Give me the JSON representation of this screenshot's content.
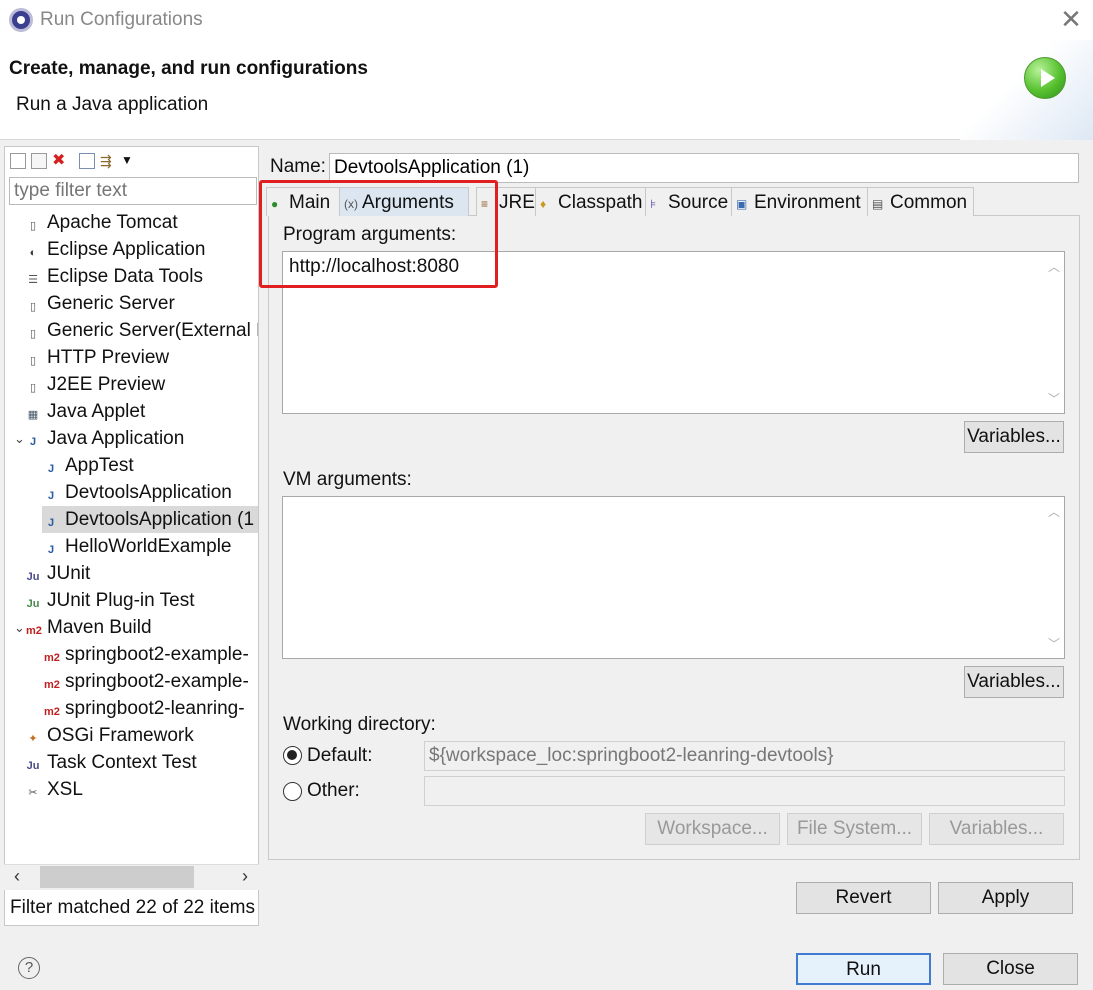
{
  "window": {
    "title": "Run Configurations"
  },
  "header": {
    "title": "Create, manage, and run configurations",
    "subtitle": "Run a Java application"
  },
  "filter": {
    "placeholder": "type filter text"
  },
  "tree": [
    {
      "label": "Apache Tomcat",
      "icon": "server-icon",
      "level": 0
    },
    {
      "label": "Eclipse Application",
      "icon": "eclipse-icon",
      "level": 0
    },
    {
      "label": "Eclipse Data Tools",
      "icon": "database-icon",
      "level": 0
    },
    {
      "label": "Generic Server",
      "icon": "server-icon",
      "level": 0
    },
    {
      "label": "Generic Server(External L",
      "icon": "server-icon",
      "level": 0
    },
    {
      "label": "HTTP Preview",
      "icon": "server-icon",
      "level": 0
    },
    {
      "label": "J2EE Preview",
      "icon": "server-icon",
      "level": 0
    },
    {
      "label": "Java Applet",
      "icon": "applet-icon",
      "level": 0
    },
    {
      "label": "Java Application",
      "icon": "java-app-icon",
      "level": 0,
      "expanded": true
    },
    {
      "label": "AppTest",
      "icon": "java-app-icon",
      "level": 1
    },
    {
      "label": "DevtoolsApplication",
      "icon": "java-app-icon",
      "level": 1
    },
    {
      "label": "DevtoolsApplication (1",
      "icon": "java-app-icon",
      "level": 1,
      "selected": true
    },
    {
      "label": "HelloWorldExample",
      "icon": "java-app-icon",
      "level": 1
    },
    {
      "label": "JUnit",
      "icon": "junit-icon",
      "level": 0
    },
    {
      "label": "JUnit Plug-in Test",
      "icon": "junit-plugin-icon",
      "level": 0
    },
    {
      "label": "Maven Build",
      "icon": "maven-icon",
      "level": 0,
      "expanded": true
    },
    {
      "label": "springboot2-example-",
      "icon": "maven-icon",
      "level": 1
    },
    {
      "label": "springboot2-example-",
      "icon": "maven-icon",
      "level": 1
    },
    {
      "label": "springboot2-leanring-",
      "icon": "maven-icon",
      "level": 1
    },
    {
      "label": "OSGi Framework",
      "icon": "osgi-icon",
      "level": 0
    },
    {
      "label": "Task Context Test",
      "icon": "junit-icon",
      "level": 0
    },
    {
      "label": "XSL",
      "icon": "xsl-icon",
      "level": 0
    }
  ],
  "filter_status": "Filter matched 22 of 22 items",
  "name": {
    "label": "Name:",
    "value": "DevtoolsApplication (1)"
  },
  "tabs": [
    {
      "label": "Main",
      "icon": "main-tab-icon"
    },
    {
      "label": "Arguments",
      "icon": "arguments-tab-icon",
      "active": true
    },
    {
      "label": "JRE",
      "icon": "jre-tab-icon"
    },
    {
      "label": "Classpath",
      "icon": "classpath-tab-icon"
    },
    {
      "label": "Source",
      "icon": "source-tab-icon"
    },
    {
      "label": "Environment",
      "icon": "environment-tab-icon"
    },
    {
      "label": "Common",
      "icon": "common-tab-icon"
    }
  ],
  "program_args": {
    "label": "Program arguments:",
    "value": "http://localhost:8080",
    "variables_label": "Variables..."
  },
  "vm_args": {
    "label": "VM arguments:",
    "value": "",
    "variables_label": "Variables..."
  },
  "working_dir": {
    "label": "Working directory:",
    "default_label": "Default:",
    "default_value": "${workspace_loc:springboot2-leanring-devtools}",
    "other_label": "Other:",
    "other_value": "",
    "workspace_label": "Workspace...",
    "filesystem_label": "File System...",
    "variables_label": "Variables..."
  },
  "buttons": {
    "revert": "Revert",
    "apply": "Apply",
    "run": "Run",
    "close": "Close"
  },
  "colors": {
    "highlight": "#e02020",
    "selection": "#d9d9d9",
    "run_badge": "#57c12f"
  }
}
